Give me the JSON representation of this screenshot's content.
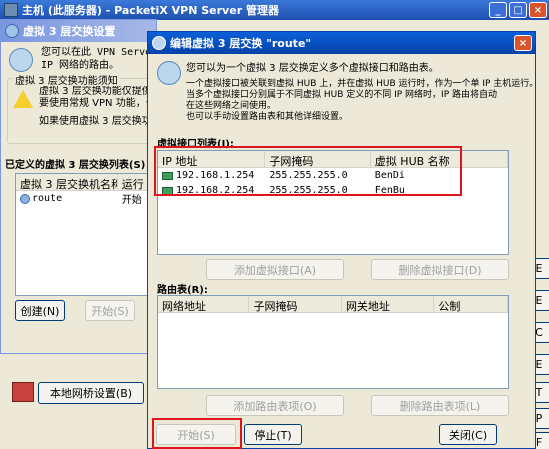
{
  "top_window": {
    "title": "主机 (此服务器) - PacketiX VPN Server 管理器"
  },
  "l3_window": {
    "title": "虚拟 3 层交换设置",
    "description": "您可以在此 VPN Server 的\nIP 网络的路由。",
    "notice_group_label": "虚拟 3 层交换功能须知",
    "notice_text": "虚拟 3 层交换功能仅提供\n要使用常规 VPN 功能，也",
    "notice_text2": "如果使用虚拟 3 层交换功",
    "defined_list_label": "已定义的虚拟 3 层交换列表(S)",
    "columns": [
      "虚拟 3 层交换机名称",
      "运行"
    ],
    "rows": [
      {
        "name": "route",
        "status": "开始"
      }
    ],
    "create_button": "创建(N)",
    "start_button": "开始(S)"
  },
  "bottom_bar": {
    "bridge_button": "本地网桥设置(B)"
  },
  "right_buttons": [
    "E",
    "E",
    "C",
    "E",
    "T",
    "P",
    "F"
  ],
  "edit_dialog": {
    "title": "编辑虚拟 3 层交换 \"route\"",
    "intro": "您可以为一个虚拟 3 层交换定义多个虚拟接口和路由表。",
    "description_lines": [
      "一个虚拟接口被关联到虚拟 HUB 上，并在虚拟 HUB 运行时，作为一个单 IP 主机运行。",
      "当多个虚拟接口分别属于不同虚拟 HUB 定义的不同 IP 网络时，IP 路由将自动",
      "在这些网络之间使用。",
      "也可以手动设置路由表和其他详细设置。"
    ],
    "interface_section_label": "虚拟接口列表(I):",
    "interface_columns": [
      "IP 地址",
      "子网掩码",
      "虚拟 HUB 名称"
    ],
    "interfaces": [
      {
        "ip": "192.168.1.254",
        "mask": "255.255.255.0",
        "hub": "BenDi"
      },
      {
        "ip": "192.168.2.254",
        "mask": "255.255.255.0",
        "hub": "FenBu"
      }
    ],
    "add_interface_button": "添加虚拟接口(A)",
    "delete_interface_button": "删除虚拟接口(D)",
    "routing_section_label": "路由表(R):",
    "routing_columns": [
      "网络地址",
      "子网掩码",
      "网关地址",
      "公制"
    ],
    "add_route_button": "添加路由表项(O)",
    "delete_route_button": "删除路由表项(L)",
    "start_button": "开始(S)",
    "stop_button": "停止(T)",
    "close_button": "关闭(C)"
  },
  "colors": {
    "highlight_red": "#e0151b",
    "titlebar_active": "#0a5fd8"
  }
}
